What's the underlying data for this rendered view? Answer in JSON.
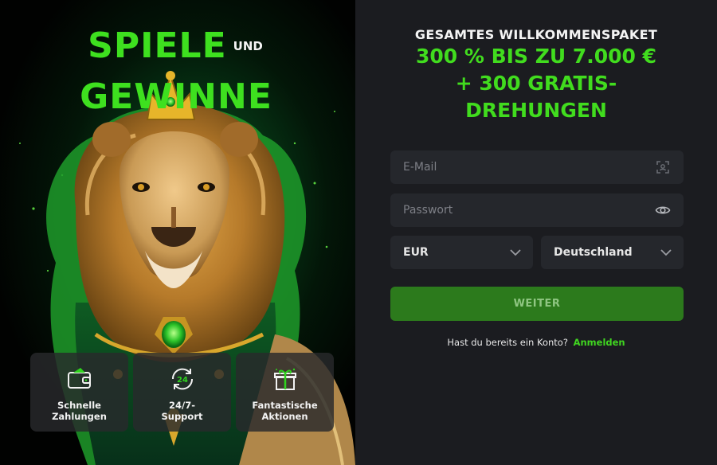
{
  "promo": {
    "headline_big_1": "SPIELE",
    "headline_small": "UND",
    "headline_big_2": "GEWINNE",
    "features": [
      {
        "icon": "wallet-icon",
        "label": "Schnelle\nZahlungen"
      },
      {
        "icon": "support-24-icon",
        "label": "24/7-\nSupport"
      },
      {
        "icon": "gift-icon",
        "label": "Fantastische\nAktionen"
      }
    ]
  },
  "offer": {
    "heading": "GESAMTES WILLKOMMENSPAKET",
    "amount_line1": "300 % BIS ZU 7.000 €",
    "amount_line2": "+ 300 GRATIS-",
    "amount_line3": "DREHUNGEN"
  },
  "form": {
    "email_placeholder": "E-Mail",
    "email_value": "",
    "password_placeholder": "Passwort",
    "password_value": "",
    "currency": "EUR",
    "country": "Deutschland",
    "submit_label": "WEITER",
    "login_prompt": "Hast du bereits ein Konto?",
    "login_link": "Anmelden"
  },
  "colors": {
    "accent": "#41dc1e",
    "button": "#2c7a1c",
    "panel": "#1b1c20",
    "field": "#25272c"
  }
}
